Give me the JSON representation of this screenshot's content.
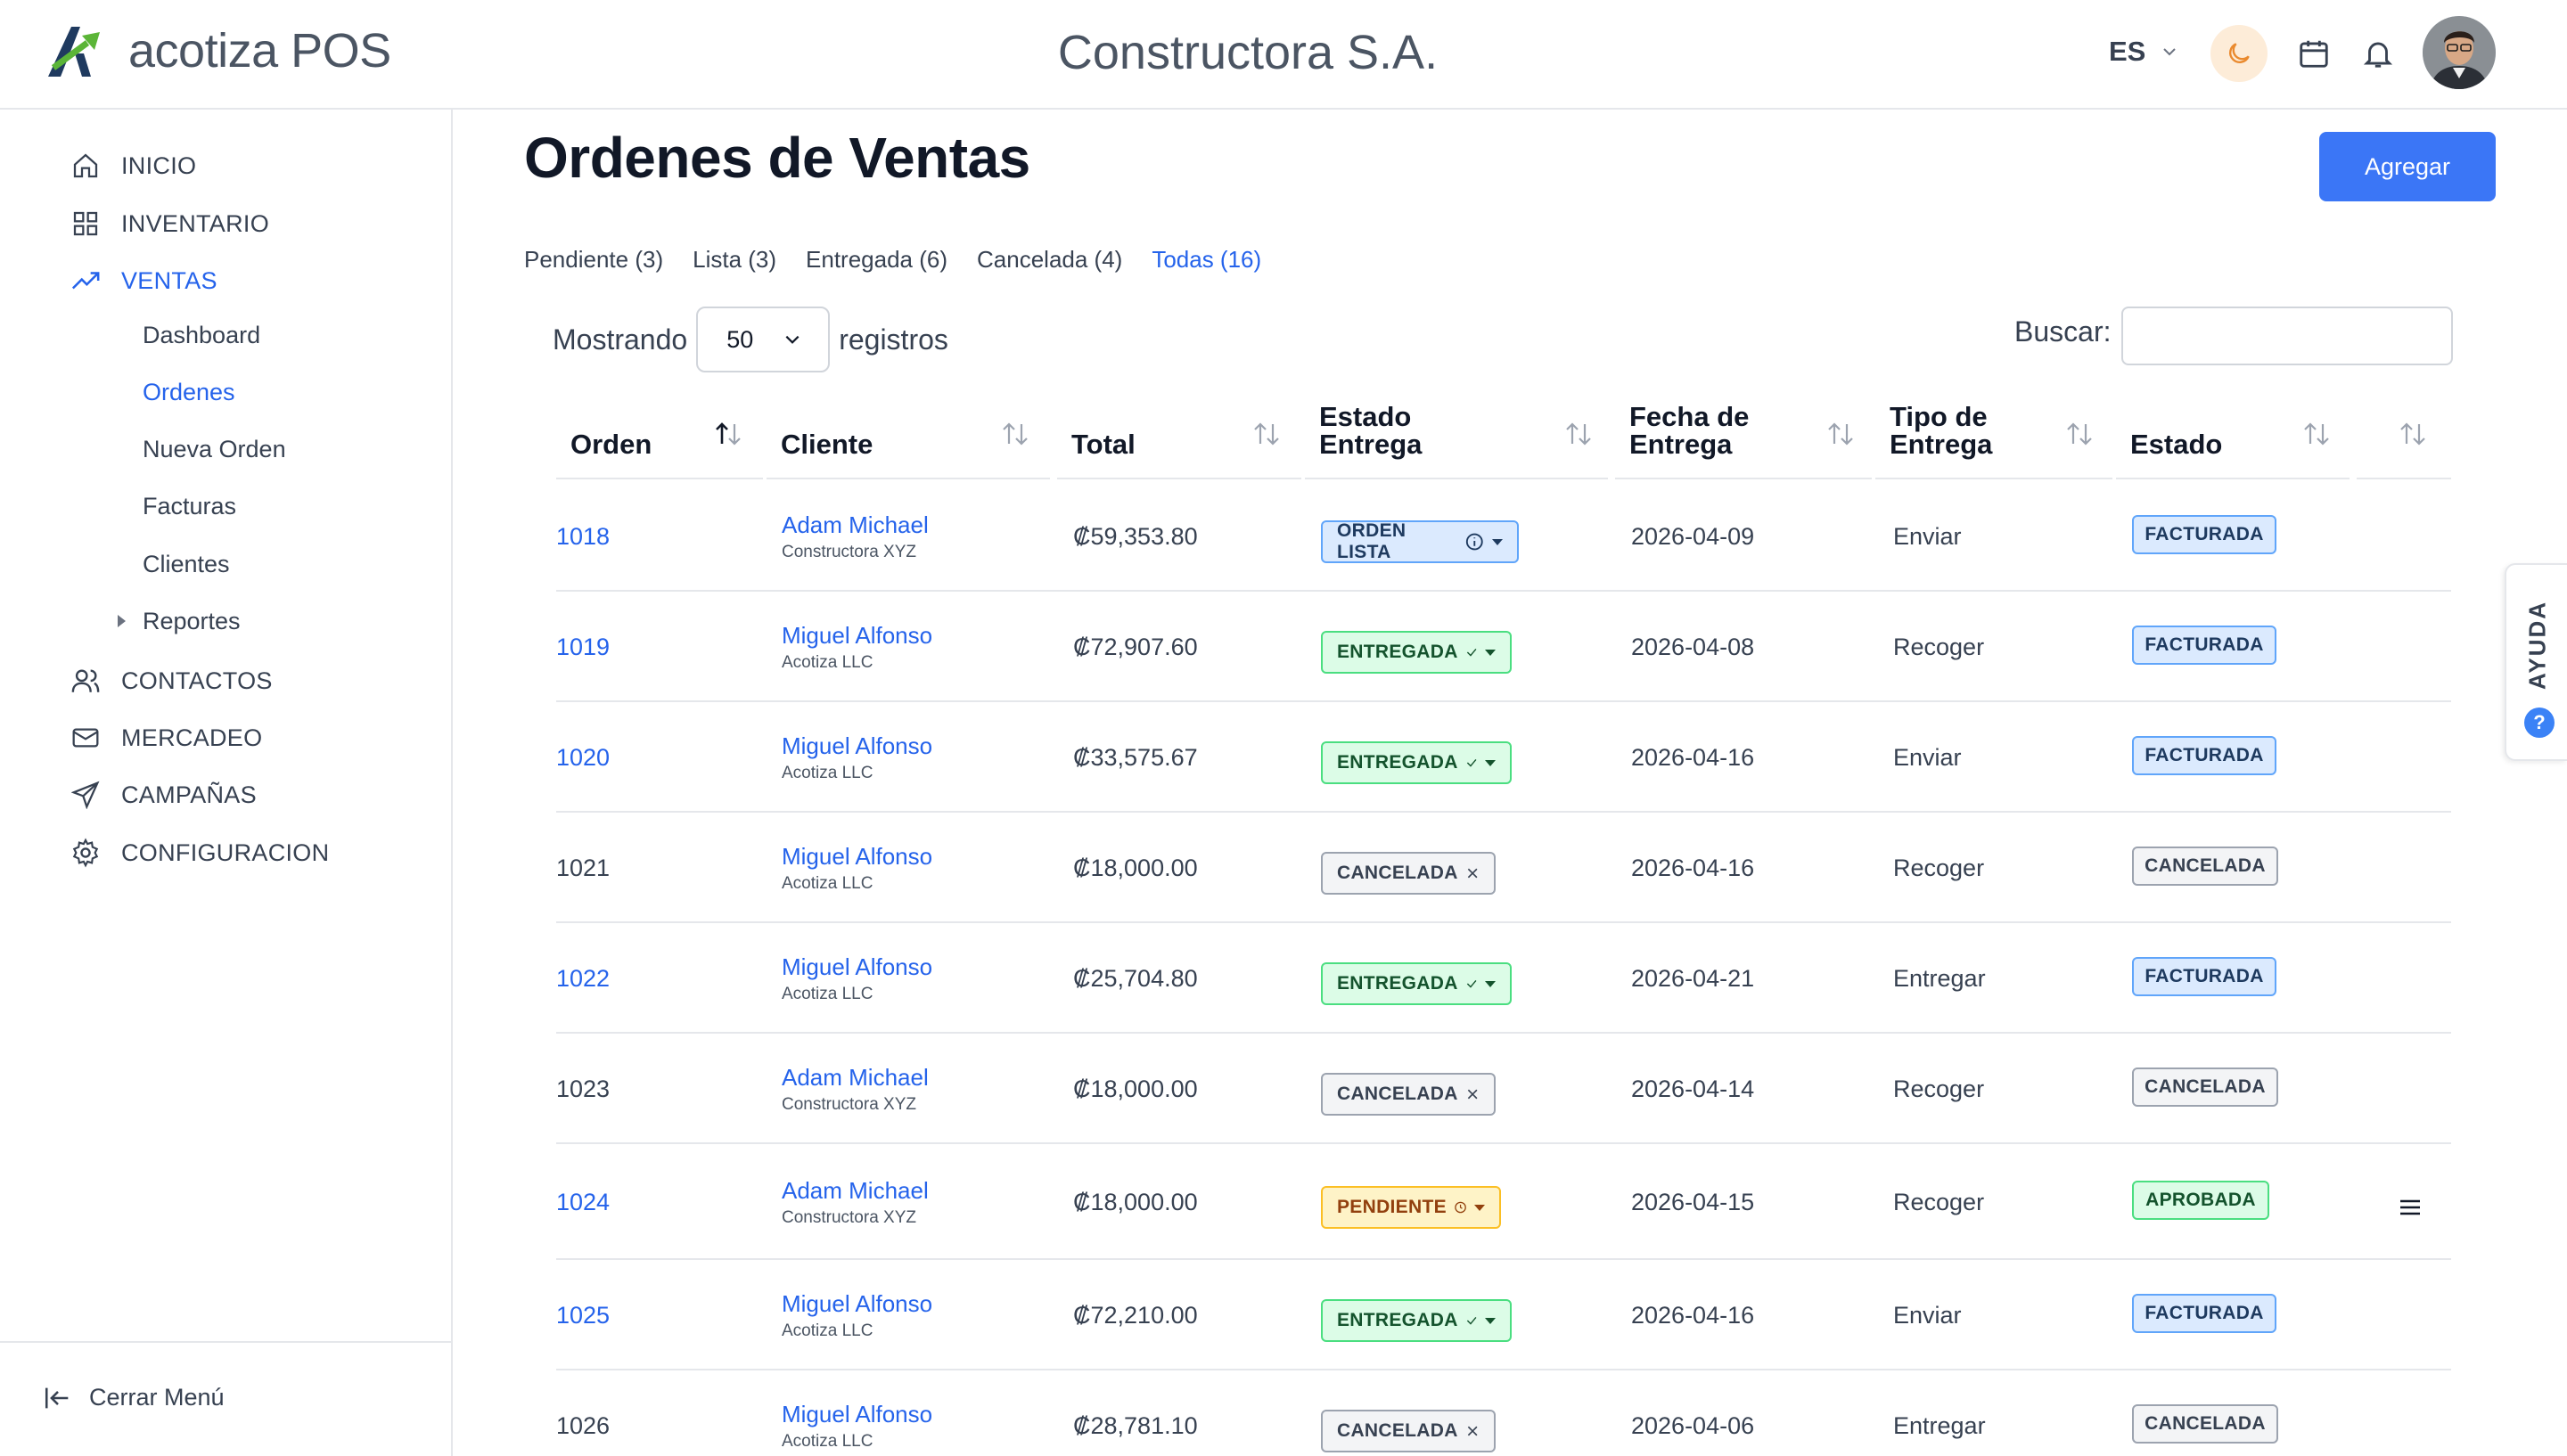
{
  "header": {
    "logo_text": "acotiza POS",
    "company": "Constructora S.A.",
    "language": "ES"
  },
  "sidebar": {
    "items": [
      {
        "label": "INICIO",
        "icon": "home-icon"
      },
      {
        "label": "INVENTARIO",
        "icon": "grid-icon"
      },
      {
        "label": "VENTAS",
        "icon": "trending-up-icon"
      },
      {
        "label": "CONTACTOS",
        "icon": "users-icon"
      },
      {
        "label": "MERCADEO",
        "icon": "mail-icon"
      },
      {
        "label": "CAMPAÑAS",
        "icon": "send-icon"
      },
      {
        "label": "CONFIGURACION",
        "icon": "gear-icon"
      }
    ],
    "sub_items": [
      "Dashboard",
      "Ordenes",
      "Nueva Orden",
      "Facturas",
      "Clientes",
      "Reportes"
    ],
    "close_menu": "Cerrar Menú"
  },
  "main": {
    "title": "Ordenes de Ventas",
    "add_button": "Agregar",
    "tabs": [
      "Pendiente (3)",
      "Lista (3)",
      "Entregada (6)",
      "Cancelada (4)",
      "Todas (16)"
    ],
    "showing_prefix": "Mostrando",
    "page_size": "50",
    "showing_suffix": "registros",
    "search_label": "Buscar:",
    "search_value": ""
  },
  "table": {
    "headers": [
      "Orden",
      "Cliente",
      "Total",
      "Estado Entrega",
      "Fecha de Entrega",
      "Tipo de Entrega",
      "Estado"
    ],
    "rows": [
      {
        "orden": "1018",
        "cliente": "Adam Michael",
        "empresa": "Constructora XYZ",
        "total": "₡59,353.80",
        "entrega": "ORDEN LISTA",
        "fecha": "2026-04-09",
        "tipo": "Enviar",
        "estado": "FACTURADA"
      },
      {
        "orden": "1019",
        "cliente": "Miguel Alfonso",
        "empresa": "Acotiza LLC",
        "total": "₡72,907.60",
        "entrega": "ENTREGADA",
        "fecha": "2026-04-08",
        "tipo": "Recoger",
        "estado": "FACTURADA"
      },
      {
        "orden": "1020",
        "cliente": "Miguel Alfonso",
        "empresa": "Acotiza LLC",
        "total": "₡33,575.67",
        "entrega": "ENTREGADA",
        "fecha": "2026-04-16",
        "tipo": "Enviar",
        "estado": "FACTURADA"
      },
      {
        "orden": "1021",
        "cliente": "Miguel Alfonso",
        "empresa": "Acotiza LLC",
        "total": "₡18,000.00",
        "entrega": "CANCELADA",
        "fecha": "2026-04-16",
        "tipo": "Recoger",
        "estado": "CANCELADA"
      },
      {
        "orden": "1022",
        "cliente": "Miguel Alfonso",
        "empresa": "Acotiza LLC",
        "total": "₡25,704.80",
        "entrega": "ENTREGADA",
        "fecha": "2026-04-21",
        "tipo": "Entregar",
        "estado": "FACTURADA"
      },
      {
        "orden": "1023",
        "cliente": "Adam Michael",
        "empresa": "Constructora XYZ",
        "total": "₡18,000.00",
        "entrega": "CANCELADA",
        "fecha": "2026-04-14",
        "tipo": "Recoger",
        "estado": "CANCELADA"
      },
      {
        "orden": "1024",
        "cliente": "Adam Michael",
        "empresa": "Constructora XYZ",
        "total": "₡18,000.00",
        "entrega": "PENDIENTE",
        "fecha": "2026-04-15",
        "tipo": "Recoger",
        "estado": "APROBADA"
      },
      {
        "orden": "1025",
        "cliente": "Miguel Alfonso",
        "empresa": "Acotiza LLC",
        "total": "₡72,210.00",
        "entrega": "ENTREGADA",
        "fecha": "2026-04-16",
        "tipo": "Enviar",
        "estado": "FACTURADA"
      },
      {
        "orden": "1026",
        "cliente": "Miguel Alfonso",
        "empresa": "Acotiza LLC",
        "total": "₡28,781.10",
        "entrega": "CANCELADA",
        "fecha": "2026-04-06",
        "tipo": "Entregar",
        "estado": "CANCELADA"
      }
    ]
  },
  "help": {
    "label": "AYUDA",
    "icon_glyph": "?"
  },
  "colors": {
    "accent": "#3b76f6",
    "link": "#2563eb",
    "logo_green": "#5bb537",
    "logo_dark": "#1f3a5f"
  }
}
